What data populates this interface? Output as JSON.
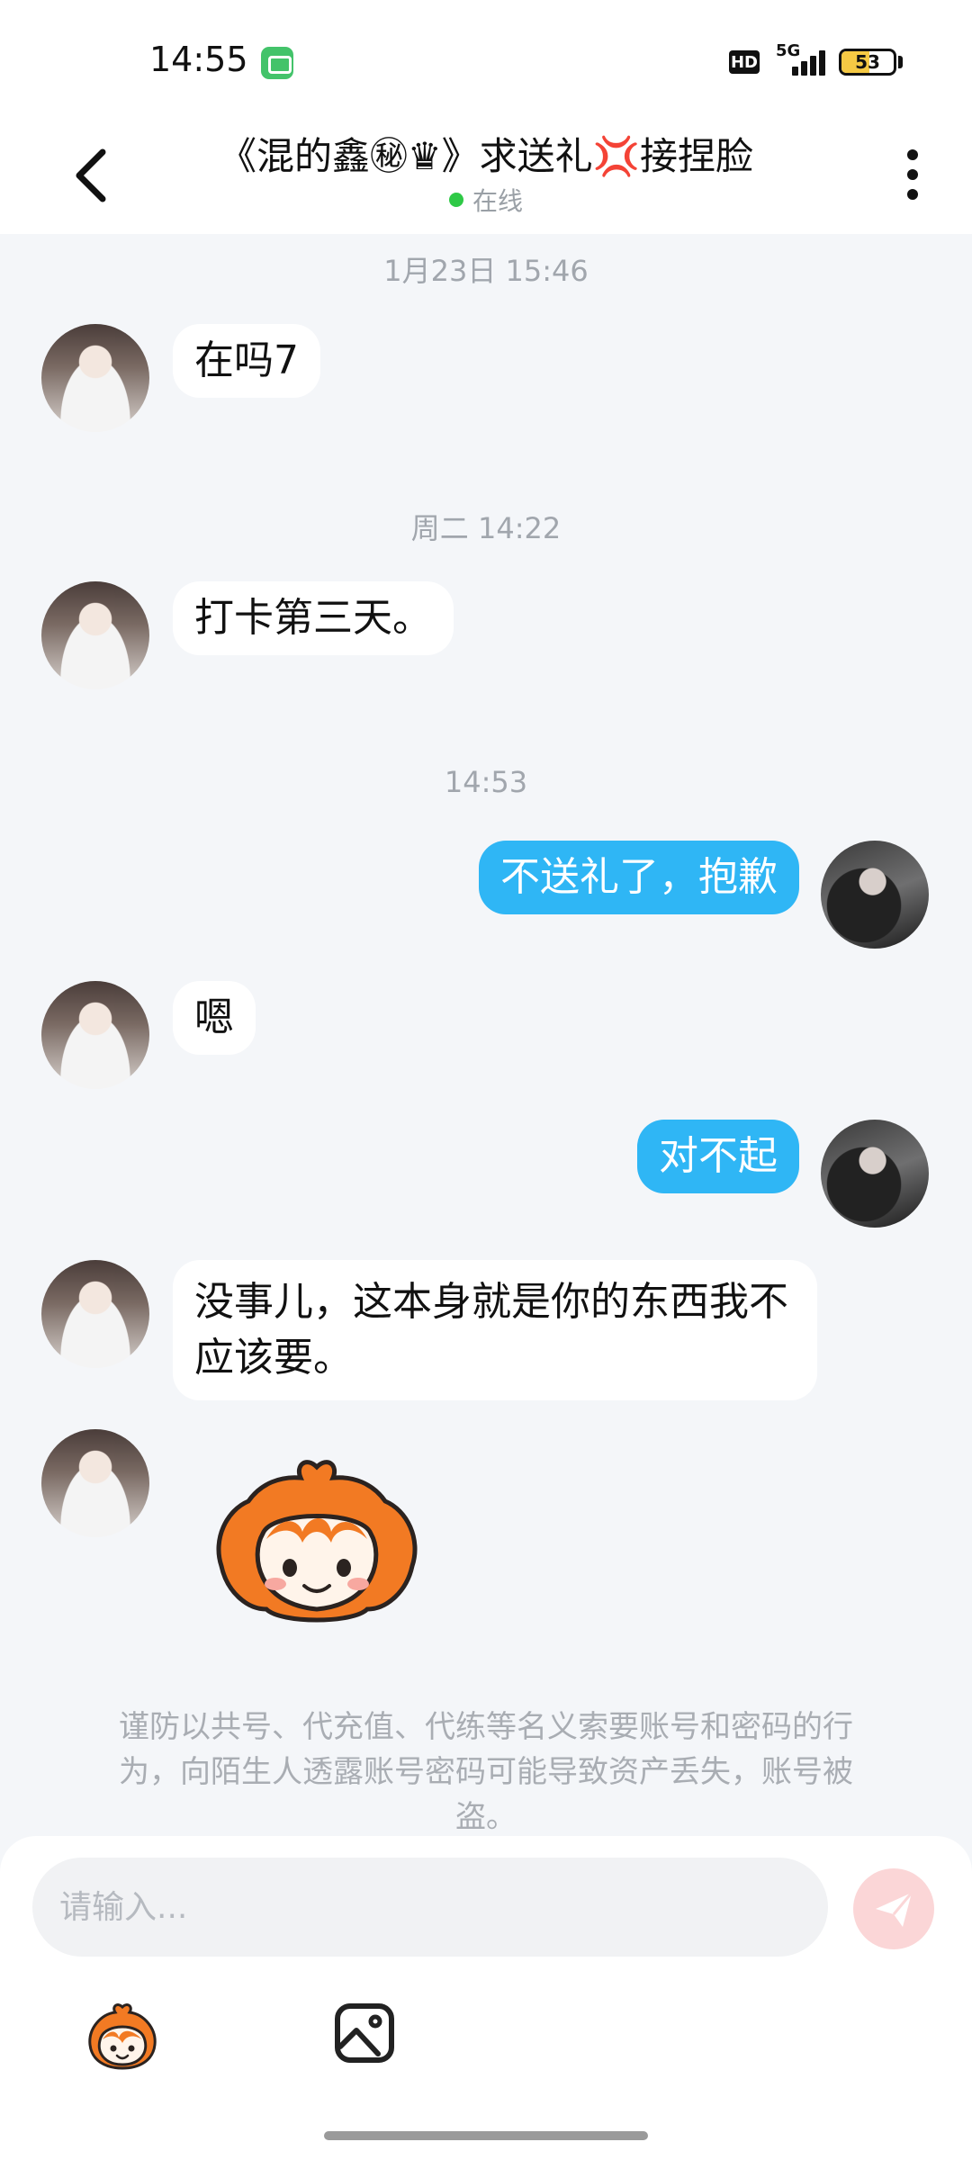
{
  "status_bar": {
    "time": "14:55",
    "network": "5G",
    "hd": "HD",
    "battery": "53",
    "battery_level": 0.53
  },
  "header": {
    "title": "《混的鑫㊙♛》求送礼💢接捏脸",
    "status": "在线",
    "icons": [
      "back-arrow-icon",
      "more-vertical-icon"
    ]
  },
  "chat": {
    "messages": [
      {
        "type": "timestamp",
        "text": "1月23日 15:46"
      },
      {
        "type": "incoming",
        "text": "在吗7"
      },
      {
        "type": "timestamp",
        "text": "周二 14:22"
      },
      {
        "type": "incoming",
        "text": "打卡第三天。"
      },
      {
        "type": "timestamp",
        "text": "14:53"
      },
      {
        "type": "outgoing",
        "text": "不送礼了，抱歉"
      },
      {
        "type": "incoming",
        "text": "嗯"
      },
      {
        "type": "outgoing",
        "text": "对不起"
      },
      {
        "type": "incoming",
        "text": "没事儿，这本身就是你的东西我不应该要。"
      },
      {
        "type": "incoming-sticker",
        "sticker": "mascot-sticker"
      }
    ]
  },
  "warning": "谨防以共号、代充值、代练等名义索要账号和密码的行为，向陌生人透露账号密码可能导致资产丢失，账号被盗。",
  "input": {
    "placeholder": "请输入...",
    "value": ""
  },
  "toolbar": {
    "icons": [
      "emoji-mascot-icon",
      "image-icon",
      "send-icon"
    ]
  },
  "colors": {
    "outgoing_bubble": "#2fb6f5",
    "incoming_bubble": "#ffffff",
    "background": "#f4f6f9",
    "online": "#2ec946",
    "send_disabled": "#fbd6d7"
  }
}
